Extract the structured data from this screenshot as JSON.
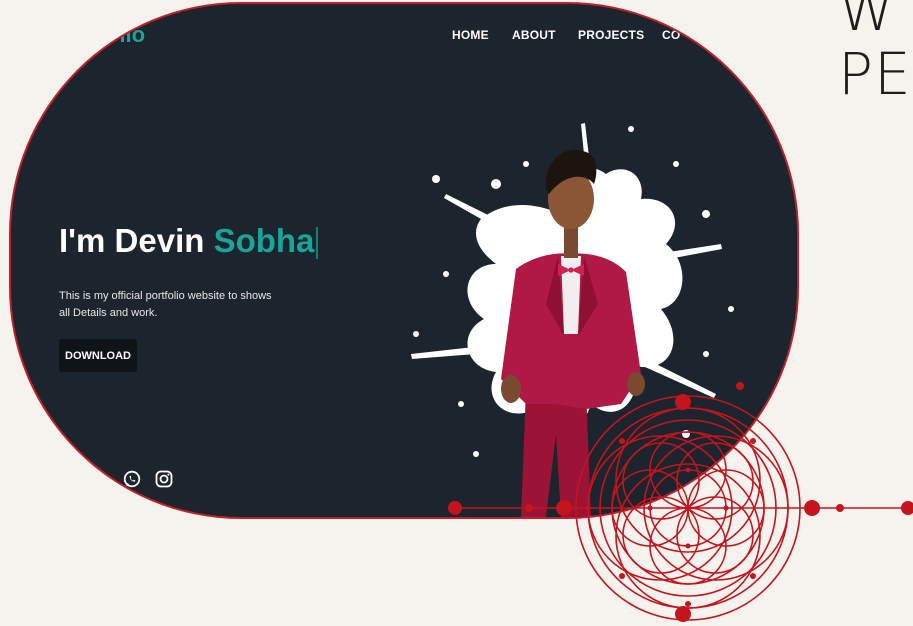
{
  "slide": {
    "heading_line1": "W",
    "heading_line2": "PE"
  },
  "site": {
    "logo": "olio",
    "nav": [
      "HOME",
      "ABOUT",
      "PROJECTS",
      "CO"
    ],
    "hero": {
      "prefix": "I'm Devin ",
      "name": "Sobha",
      "description": "This is my official portfolio website to shows all Details and work.",
      "download_label": "DOWNLOAD"
    }
  },
  "colors": {
    "accent": "#16a69a",
    "background": "#1c242d",
    "frame": "#c0202a",
    "suit": "#b01845"
  },
  "icons": [
    "whatsapp-icon",
    "instagram-icon"
  ]
}
